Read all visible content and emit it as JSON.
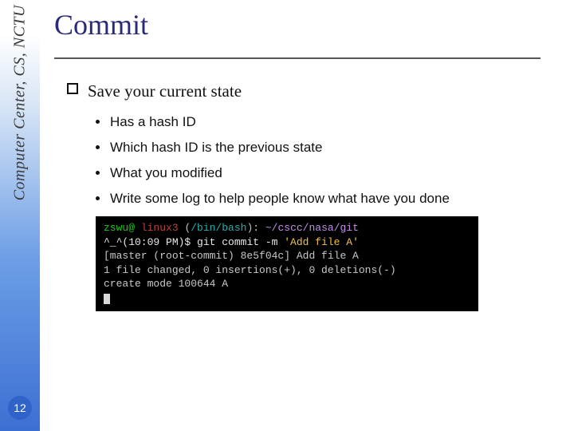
{
  "sidebar_label": "Computer Center, CS, NCTU",
  "page_number": "12",
  "title": "Commit",
  "bullet": {
    "text": "Save your current state",
    "subs": [
      "Has a hash ID",
      "Which hash ID is the previous state",
      "What you modified",
      "Write some log to help people know what have you done"
    ]
  },
  "terminal": {
    "user": "zswu@",
    "host": " linux3 ",
    "lparen": "(",
    "shell": "/bin/bash",
    "rparen_colon": "): ",
    "path": "~/cscc/nasa/git",
    "prompt_prefix": "^_^(10:09 PM)$ ",
    "cmd": "git commit -m ",
    "arg": "'Add file A'",
    "out1": "[master (root-commit) 8e5f04c] Add file A",
    "out2": " 1 file changed, 0 insertions(+), 0 deletions(-)",
    "out3": " create mode 100644 A"
  }
}
